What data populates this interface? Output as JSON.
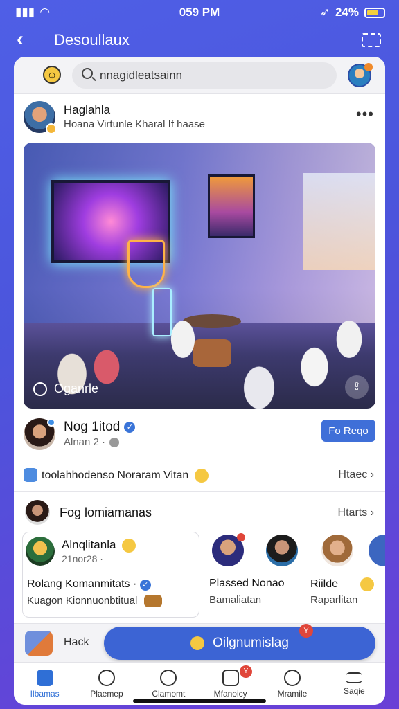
{
  "status_bar": {
    "time": "059 PM",
    "battery": "24%"
  },
  "header": {
    "title": "Desoullaux"
  },
  "search": {
    "value": "nnagidleatsainn",
    "placeholder": ""
  },
  "post": {
    "author": "Haglahla",
    "subtitle": "Hoana Virtunle Kharal If haase",
    "image_caption": "Oganrle"
  },
  "author_row": {
    "name": "Nog 1itod",
    "sub": "Alnan 2 ·",
    "follow_label": "Fo Reqo"
  },
  "info_row": {
    "text": "toolahhodenso Noraram Vitan",
    "link": "Htaec"
  },
  "group_row": {
    "title": "Fog lomiamanas",
    "link": "Htarts"
  },
  "mini_card": {
    "name": "Alnqlitanla",
    "time": "21nor28 ·",
    "line1": "Rolang Komanmitats ·",
    "line2": "Kuagon Kionnuonbtitual"
  },
  "side_people": [
    {
      "name": "Plassed Nonao",
      "sub": "Bamaliatan"
    },
    {
      "name": "Riilde",
      "sub": "Raparlitan"
    }
  ],
  "strip": {
    "label": "Hack",
    "cta": "Oilgnumislag",
    "badge": "Y"
  },
  "tabs": [
    {
      "label": "Ilbamas",
      "icon": "home-icon"
    },
    {
      "label": "Plaemep",
      "icon": "search-icon"
    },
    {
      "label": "Clamomt",
      "icon": "people-icon"
    },
    {
      "label": "Mfanoicy",
      "icon": "messages-icon",
      "badge": "Y"
    },
    {
      "label": "Mramile",
      "icon": "chat-icon"
    },
    {
      "label": "Saqie",
      "icon": "menu-icon"
    }
  ]
}
